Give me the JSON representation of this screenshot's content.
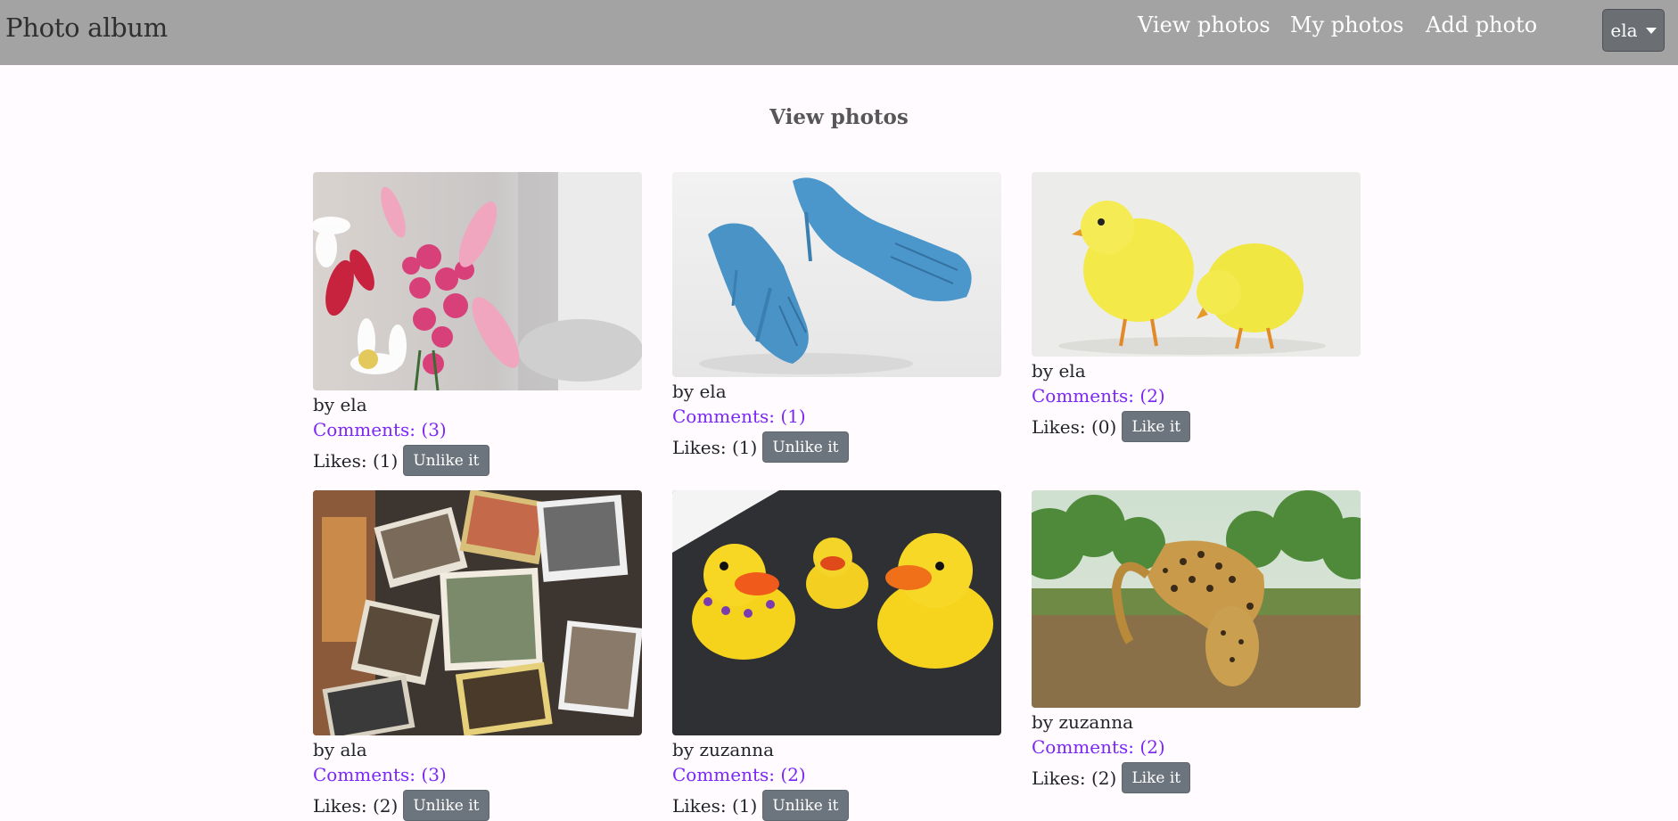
{
  "app": {
    "brand": "Photo album"
  },
  "nav": {
    "links": [
      "View photos",
      "My photos",
      "Add photo"
    ],
    "user": "ela"
  },
  "page": {
    "title": "View photos"
  },
  "photos": [
    {
      "author": "by ela",
      "comments": "Comments: (3)",
      "likes": "Likes: (1)",
      "action": "Unlike it",
      "subject": "pink flower bouquet"
    },
    {
      "author": "by ela",
      "comments": "Comments: (1)",
      "likes": "Likes: (1)",
      "action": "Unlike it",
      "subject": "blue flipper high heels"
    },
    {
      "author": "by ela",
      "comments": "Comments: (2)",
      "likes": "Likes: (0)",
      "action": "Like it",
      "subject": "two yellow chicks"
    },
    {
      "author": "by ala",
      "comments": "Comments: (3)",
      "likes": "Likes: (2)",
      "action": "Unlike it",
      "subject": "scattered photos"
    },
    {
      "author": "by zuzanna",
      "comments": "Comments: (2)",
      "likes": "Likes: (1)",
      "action": "Unlike it",
      "subject": "rubber ducks"
    },
    {
      "author": "by zuzanna",
      "comments": "Comments: (2)",
      "likes": "Likes: (2)",
      "action": "Like it",
      "subject": "leopard"
    }
  ],
  "colors": {
    "navbar": "#a3a3a3",
    "link": "#7b27f5",
    "button": "#6c757d",
    "background": "#fffbfe"
  },
  "icons": {
    "user_dropdown": "caret-down-icon"
  }
}
